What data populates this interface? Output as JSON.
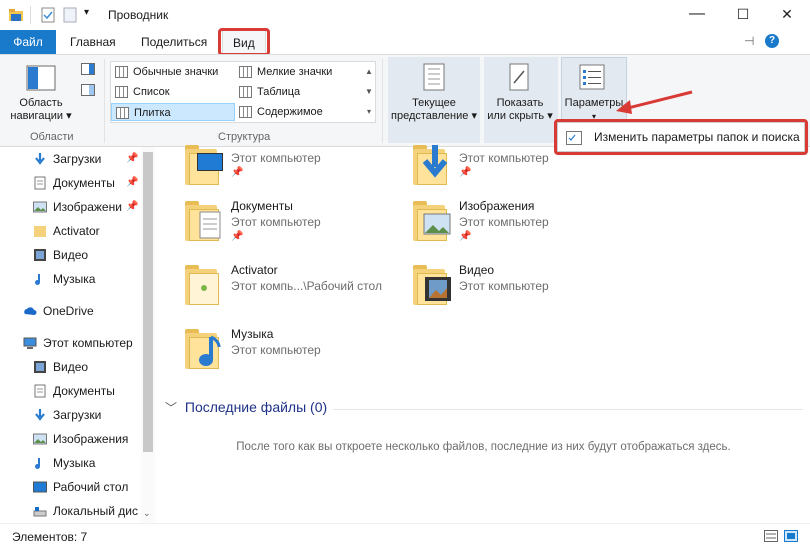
{
  "window": {
    "title": "Проводник",
    "qa_dropdown_icon": "chevron-down-icon",
    "minimize": "—",
    "maximize": "☐",
    "close": "✕"
  },
  "tabs": [
    {
      "label": "Файл"
    },
    {
      "label": "Главная"
    },
    {
      "label": "Поделиться"
    },
    {
      "label": "Вид"
    }
  ],
  "ribbon": {
    "nav_pane": {
      "label_line1": "Область",
      "label_line2": "навигации",
      "group": "Области"
    },
    "layout": {
      "items": [
        "Обычные значки",
        "Мелкие значки",
        "Список",
        "Таблица",
        "Плитка",
        "Содержимое"
      ],
      "group": "Структура"
    },
    "current_view": {
      "line1": "Текущее",
      "line2": "представление"
    },
    "show_hide": {
      "line1": "Показать",
      "line2": "или скрыть"
    },
    "options": {
      "label": "Параметры"
    },
    "popup_item": "Изменить параметры папок и поиска"
  },
  "sidebar": {
    "quick": [
      {
        "label": "Загрузки",
        "icon": "download-arrow-icon"
      },
      {
        "label": "Документы",
        "icon": "documents-icon"
      },
      {
        "label": "Изображени",
        "icon": "pictures-icon"
      },
      {
        "label": "Activator",
        "icon": "folder-icon"
      },
      {
        "label": "Видео",
        "icon": "video-icon"
      },
      {
        "label": "Музыка",
        "icon": "music-icon"
      }
    ],
    "onedrive": "OneDrive",
    "this_pc": "Этот компьютер",
    "pc_items": [
      {
        "label": "Видео"
      },
      {
        "label": "Документы"
      },
      {
        "label": "Загрузки"
      },
      {
        "label": "Изображения"
      },
      {
        "label": "Музыка"
      },
      {
        "label": "Рабочий стол"
      },
      {
        "label": "Локальный дис"
      }
    ]
  },
  "content": {
    "tiles": [
      {
        "title": "",
        "sub": "Этот компьютер"
      },
      {
        "title": "",
        "sub": "Этот компьютер"
      },
      {
        "title": "Документы",
        "sub": "Этот компьютер"
      },
      {
        "title": "Изображения",
        "sub": "Этот компьютер"
      },
      {
        "title": "Activator",
        "sub": "Этот компь...\\Рабочий стол"
      },
      {
        "title": "Видео",
        "sub": "Этот компьютер"
      },
      {
        "title": "Музыка",
        "sub": "Этот компьютер"
      }
    ],
    "recent_header": "Последние файлы (0)",
    "recent_empty": "После того как вы откроете несколько файлов, последние из них будут отображаться здесь."
  },
  "status": {
    "items_count": "Элементов: 7"
  },
  "colors": {
    "accent": "#1979ca",
    "highlight_red": "#d83a35",
    "selected": "#cce8ff"
  }
}
